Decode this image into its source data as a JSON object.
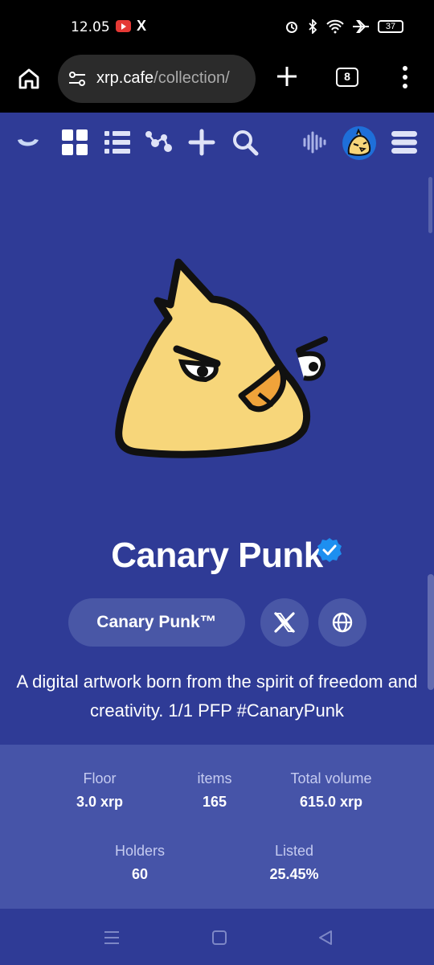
{
  "status_bar": {
    "time": "12.05",
    "battery": "37",
    "x_label": "X"
  },
  "browser": {
    "url_domain": "xrp.cafe",
    "url_path": "/collection/",
    "tab_count": "8"
  },
  "collection": {
    "name": "Canary Punk",
    "tag_label": "Canary Punk™",
    "description": "A digital artwork born from the spirit of freedom and creativity. 1/1 PFP #CanaryPunk"
  },
  "stats": {
    "floor": {
      "label": "Floor",
      "value": "3.0 xrp"
    },
    "items": {
      "label": "items",
      "value": "165"
    },
    "total_volume": {
      "label": "Total volume",
      "value": "615.0 xrp"
    },
    "holders": {
      "label": "Holders",
      "value": "60"
    },
    "listed": {
      "label": "Listed",
      "value": "25.45%"
    }
  },
  "colors": {
    "page_bg": "#2f3b96",
    "stats_bg": "#4654a8",
    "pill_bg": "#4957a6",
    "bird_yellow": "#f7d67a",
    "verified_blue": "#1d8ff0"
  },
  "icons": [
    "home-icon",
    "tune-icon",
    "plus-icon",
    "tabs-icon",
    "more-vert-icon",
    "logo-icon",
    "grid-icon",
    "list-icon",
    "activity-icon",
    "create-icon",
    "search-icon",
    "audio-icon",
    "menu-icon",
    "verified-icon",
    "x-icon",
    "globe-icon"
  ]
}
